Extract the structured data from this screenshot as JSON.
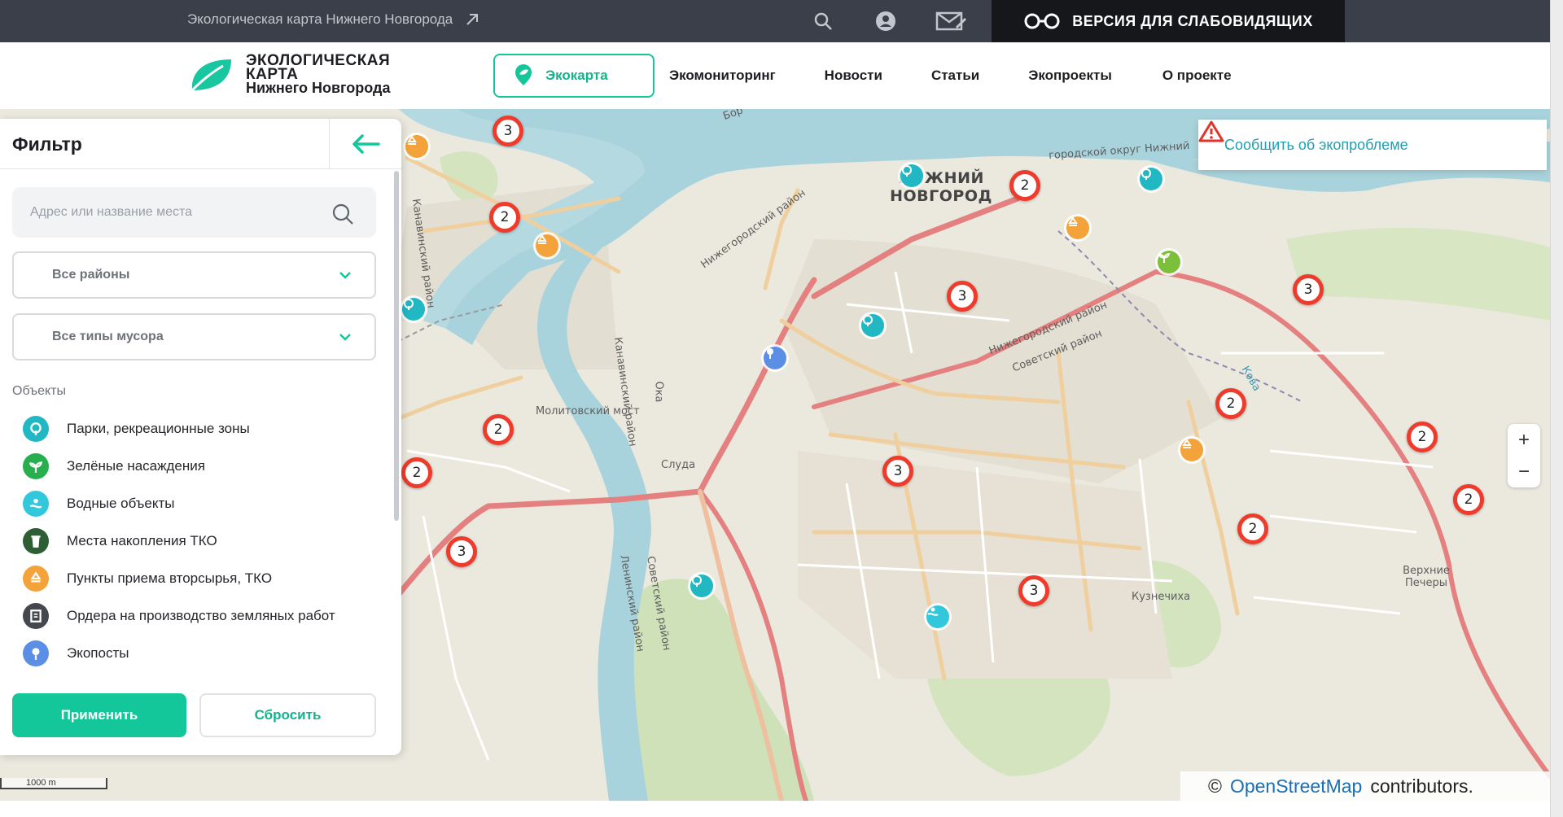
{
  "topbar": {
    "site_link": "Экологическая карта Нижнего Новгорода",
    "accessibility": "ВЕРСИЯ ДЛЯ СЛАБОВИДЯЩИХ",
    "icons": [
      "search-icon",
      "user-icon",
      "mail-icon",
      "glasses-icon",
      "external-link-icon"
    ]
  },
  "header": {
    "logo_line1": "ЭКОЛОГИЧЕСКАЯ",
    "logo_line2": "КАРТА",
    "logo_line3": "Нижнего Новгорода",
    "nav": {
      "ecomap": "Экокарта",
      "monitoring": "Экомониторинг",
      "news": "Новости",
      "articles": "Статьи",
      "projects": "Экопроекты",
      "about": "О проекте"
    }
  },
  "filter": {
    "title": "Фильтр",
    "search_placeholder": "Адрес или название места",
    "district_select": "Все районы",
    "waste_select": "Все типы мусора",
    "objects_title": "Объекты",
    "objects": [
      {
        "label": "Парки, рекреационные зоны",
        "icon": "park-icon",
        "color": "#21b8c4"
      },
      {
        "label": "Зелёные насаждения",
        "icon": "sprout-icon",
        "color": "#27ae4f"
      },
      {
        "label": "Водные объекты",
        "icon": "water-icon",
        "color": "#31c8dc"
      },
      {
        "label": "Места накопления ТКО",
        "icon": "trash-bin-icon",
        "color": "#2e5e34"
      },
      {
        "label": "Пункты приема вторсырья, ТКО",
        "icon": "recycle-icon",
        "color": "#f4a23a"
      },
      {
        "label": "Ордера на производство земляных работ",
        "icon": "document-icon",
        "color": "#44474d"
      },
      {
        "label": "Экопосты",
        "icon": "ecopost-icon",
        "color": "#5b8fe6"
      }
    ],
    "apply": "Применить",
    "reset": "Сбросить"
  },
  "map": {
    "report_button": "Сообщить об экопроблеме",
    "zoom_in": "+",
    "zoom_out": "−",
    "attribution_prefix": "©",
    "attribution_link": "OpenStreetMap",
    "attribution_suffix": "contributors.",
    "scale": "1000 m",
    "city": "НИЖНИЙ НОВГОРОД",
    "labels": {
      "gorodskoy": "городской округ Нижний",
      "nizhegorodsky_1": "Нижегородский район",
      "nizhegorodsky_2": "Нижегородский район",
      "sovetsky_1": "Советский район",
      "kanavinsky_1": "Канавинский район",
      "kanavinsky_2": "Канавинский район",
      "leninsky": "Ленинский район",
      "sovetsky_2": "Советский район",
      "molitovsky": "Молитовский мост",
      "kuznechikha": "Кузнечиха",
      "verkhnie": "Верхние Печеры",
      "kova": "Кова",
      "sluda": "Слуда",
      "oka": "Ока",
      "volga_top": "Бор"
    },
    "clusters": [
      {
        "count": "3"
      },
      {
        "count": "2"
      },
      {
        "count": "2"
      },
      {
        "count": "3"
      },
      {
        "count": "3"
      },
      {
        "count": "2"
      },
      {
        "count": "2"
      },
      {
        "count": "2"
      },
      {
        "count": "3"
      },
      {
        "count": "2"
      },
      {
        "count": "2"
      },
      {
        "count": "3"
      },
      {
        "count": "2"
      },
      {
        "count": "3"
      }
    ]
  }
}
